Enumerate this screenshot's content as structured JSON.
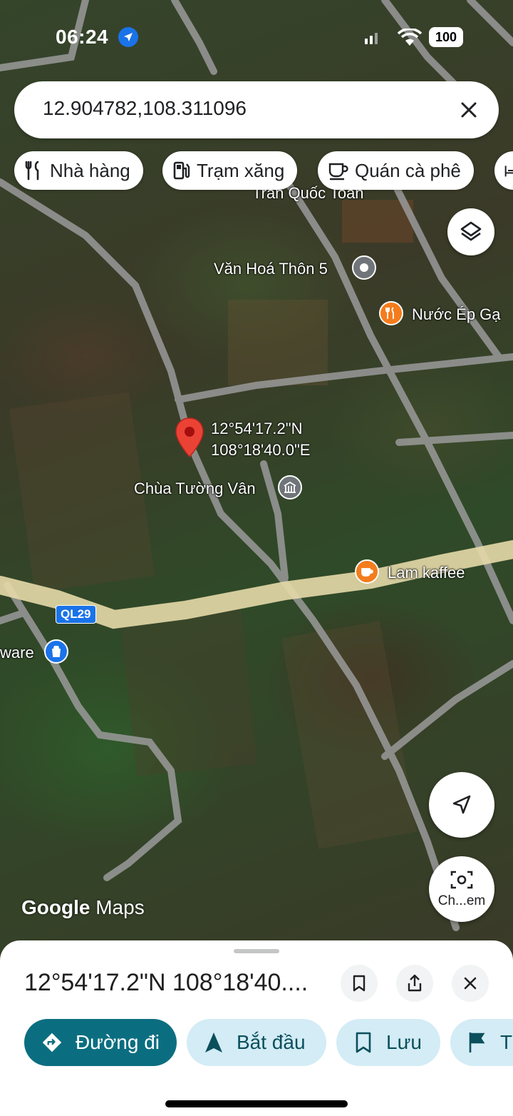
{
  "status_bar": {
    "time": "06:24",
    "battery": "100"
  },
  "search": {
    "query": "12.904782,108.311096"
  },
  "chips": [
    {
      "label": "Nhà hàng",
      "icon": "restaurant-icon"
    },
    {
      "label": "Trạm xăng",
      "icon": "gas-station-icon"
    },
    {
      "label": "Quán cà phê",
      "icon": "coffee-icon"
    }
  ],
  "map": {
    "labels": {
      "tran_quoc_toan": "Trần Quốc Toản",
      "van_hoa_thon_5": "Văn Hoá Thôn 5",
      "nuoc_ep": "Nước Ép Gạ",
      "chua_tuong_van": "Chùa Tường Vân",
      "lam_kaffee": "Lam kaffee",
      "ware": "ware",
      "road_shield": "QL29"
    },
    "pin_coords": {
      "lat": "12°54'17.2\"N",
      "lng": "108°18'40.0\"E"
    },
    "logo": {
      "brand": "Google",
      "product": "Maps"
    },
    "lens_label": "Ch...em"
  },
  "sheet": {
    "title": "12°54'17.2\"N 108°18'40....",
    "actions": [
      {
        "label": "Đường đi",
        "icon": "directions-icon"
      },
      {
        "label": "Bắt đầu",
        "icon": "navigation-start-icon"
      },
      {
        "label": "Lưu",
        "icon": "bookmark-icon"
      },
      {
        "label": "T",
        "icon": "flag-icon"
      }
    ]
  },
  "colors": {
    "primary_action": "#0b6e80",
    "tonal_action": "#d3ecf5",
    "pin": "#ea4335",
    "poi_orange": "#f47c1c",
    "poi_blue": "#1a73e8"
  }
}
